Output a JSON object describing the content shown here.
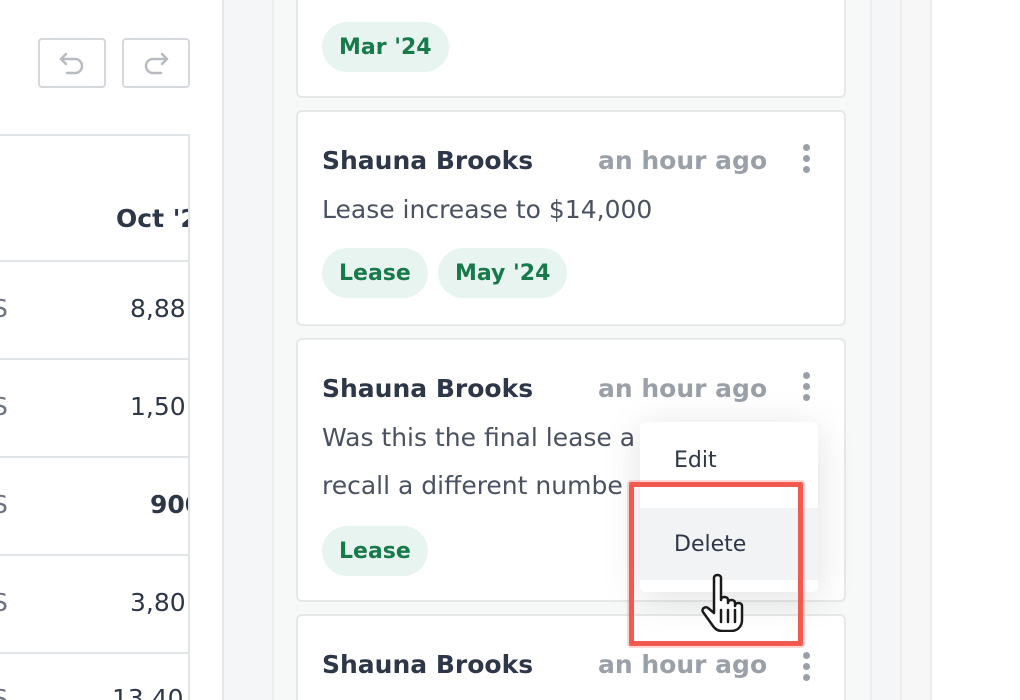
{
  "toolbar": {
    "undo_icon": "undo-icon",
    "redo_icon": "redo-icon"
  },
  "grid": {
    "column_header": "Oct '2",
    "rows": [
      {
        "prefix": "S",
        "value": "8,88"
      },
      {
        "prefix": "S",
        "value": "1,50"
      },
      {
        "prefix": "S",
        "value": "900"
      },
      {
        "prefix": "S",
        "value": "3,80"
      },
      {
        "prefix": "S",
        "value": "13,40"
      }
    ]
  },
  "comments": [
    {
      "tags": [
        "Mar '24"
      ]
    },
    {
      "author": "Shauna Brooks",
      "time": "an hour ago",
      "body": [
        "Lease increase to $14,000"
      ],
      "tags": [
        "Lease",
        "May '24"
      ]
    },
    {
      "author": "Shauna Brooks",
      "time": "an hour ago",
      "body": [
        "Was this the final lease a",
        "recall a different numbe"
      ],
      "tags": [
        "Lease"
      ]
    },
    {
      "author": "Shauna Brooks",
      "time": "an hour ago"
    }
  ],
  "menu": {
    "edit_label": "Edit",
    "delete_label": "Delete"
  },
  "colors": {
    "tag_bg": "#e7f4ef",
    "tag_text": "#187a4b",
    "highlight": "#f25a4f"
  }
}
